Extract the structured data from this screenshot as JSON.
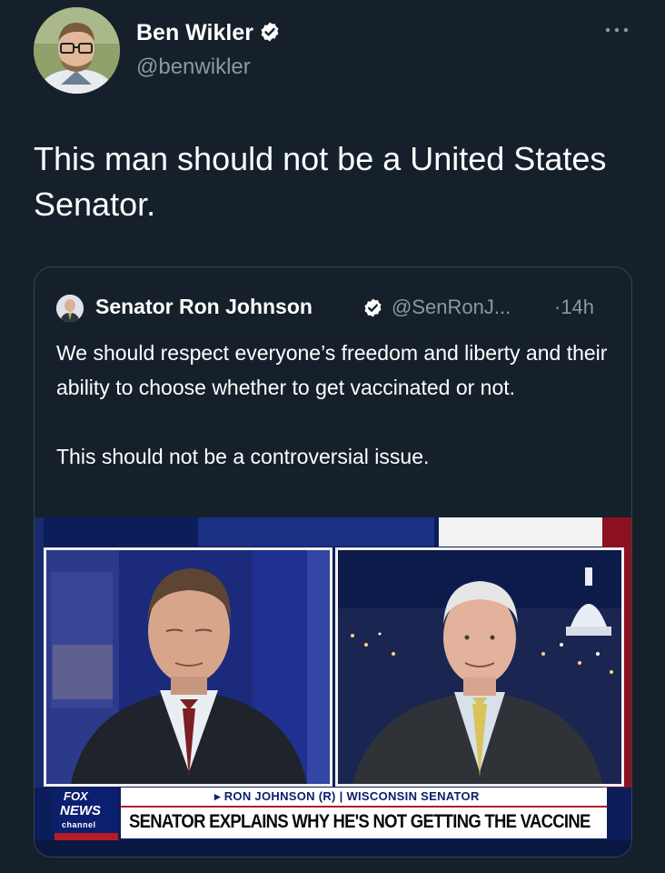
{
  "author": {
    "name": "Ben Wikler",
    "handle": "@benwikler",
    "verified": true
  },
  "tweet": {
    "text": "This man should not be a United States Senator."
  },
  "quoted_tweet": {
    "author_name": "Senator Ron Johnson",
    "handle": "@SenRonJ...",
    "time": "·14h",
    "verified": true,
    "paragraphs": [
      "We should respect everyone’s freedom and liberty and their ability to choose whether to get vaccinated or not.",
      "This should not be a controversial issue."
    ],
    "media": {
      "lower_third_name": "▸ RON JOHNSON (R) | WISCONSIN SENATOR",
      "headline": "SENATOR EXPLAINS WHY HE'S NOT GETTING THE VACCINE",
      "logo_top": "FOX",
      "logo_middle": "NEWS",
      "logo_bottom": "channel"
    }
  },
  "icons": {
    "verified": "verified-badge-icon",
    "more": "more-options-icon"
  },
  "colors": {
    "background": "#15202b",
    "secondary_text": "#8899a6",
    "border": "#38444d",
    "verified_badge": "#ffffff"
  }
}
